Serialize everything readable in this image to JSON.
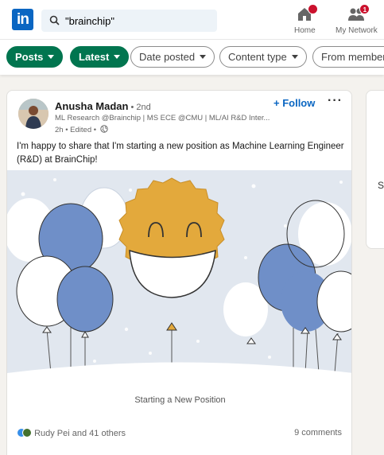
{
  "nav": {
    "logo": "in",
    "search_value": "\"brainchip\"",
    "home_label": "Home",
    "home_badge": "",
    "network_label": "My Network",
    "network_badge": "1"
  },
  "filters": [
    {
      "label": "Posts",
      "active": true
    },
    {
      "label": "Latest",
      "active": true
    },
    {
      "label": "Date posted",
      "active": false
    },
    {
      "label": "Content type",
      "active": false
    },
    {
      "label": "From member",
      "active": false
    }
  ],
  "post": {
    "author": "Anusha Madan",
    "degree": "• 2nd",
    "headline": "ML Research @Brainchip | MS ECE @CMU | ML/AI R&D Inter...",
    "meta": "2h • Edited •",
    "follow_label": "+ Follow",
    "more_label": "···",
    "text": "I'm happy to share that I'm starting a new position as Machine Learning Engineer (R&D) at BrainChip!",
    "image_caption": "Starting a New Position",
    "reactions_text": "Rudy Pei and 41 others",
    "comments_text": "9 comments"
  },
  "side": {
    "text": "S"
  },
  "colors": {
    "brand": "#0a66c2",
    "filter_active": "#01754f",
    "balloon_blue": "#6f8fc8",
    "smiley": "#e3a93c",
    "badge": "#cb112d"
  }
}
